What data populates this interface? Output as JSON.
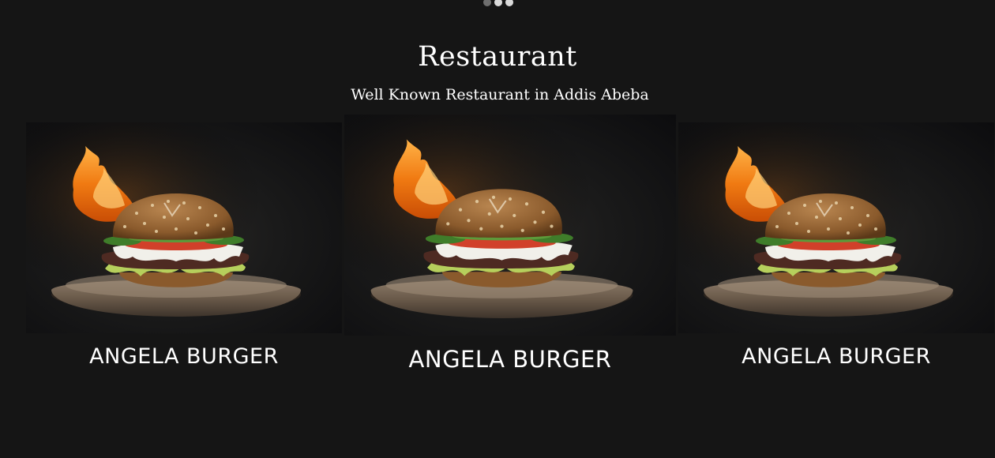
{
  "carousel": {
    "dots": [
      "dim",
      "active",
      "active"
    ]
  },
  "section": {
    "title": "Restaurant",
    "subtitle": "Well Known Restaurant in Addis Abeba"
  },
  "cards": [
    {
      "caption": "ANGELA BURGER",
      "image": "burger-with-flame"
    },
    {
      "caption": "ANGELA BURGER",
      "image": "burger-with-flame"
    },
    {
      "caption": "ANGELA BURGER",
      "image": "burger-with-flame"
    }
  ],
  "colors": {
    "background": "#151515",
    "text": "#ffffff",
    "flame": "#f08a1c",
    "bun": "#a8753f"
  }
}
